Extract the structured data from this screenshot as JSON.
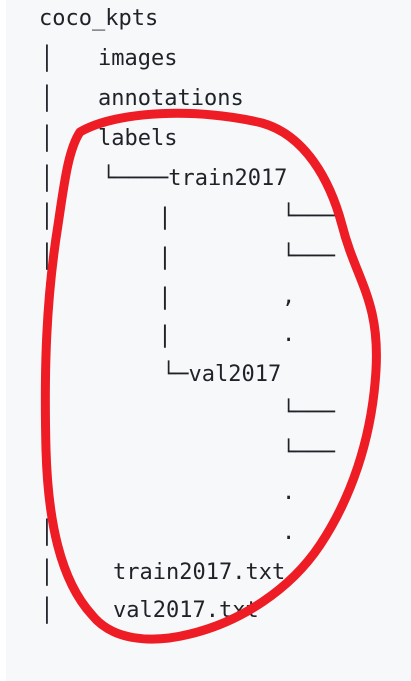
{
  "tree": {
    "root": "coco_kpts",
    "pipe": "│",
    "vbranch": "|",
    "images": "images",
    "annotations": "annotations",
    "labels": "labels",
    "train_dir": "└────train2017",
    "train_file_1": "└───",
    "train_file_2": "└───",
    "dot_comma": ",",
    "dot": ".",
    "val_dir": "└─val2017",
    "val_file_1": "└───",
    "val_file_2": "└───",
    "train_txt": "train2017.txt",
    "val_txt": "val2017.txt"
  },
  "annotation": {
    "color": "#ee1c25",
    "shape": "freehand-circle"
  }
}
